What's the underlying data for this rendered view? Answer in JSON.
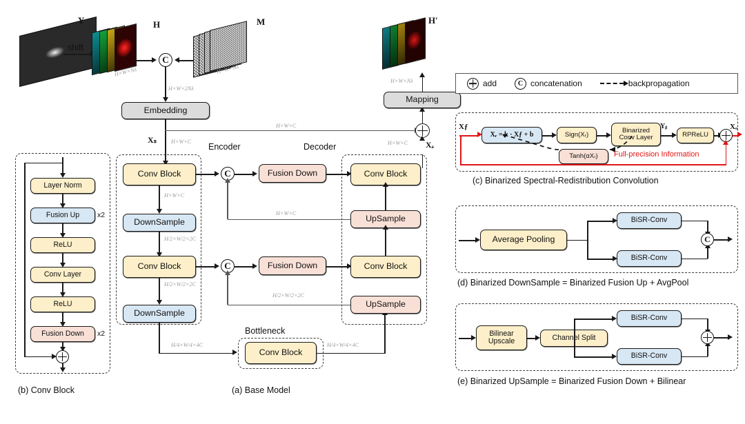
{
  "figure": {
    "panels": {
      "a": {
        "caption": "(a) Base Model",
        "encoder_label": "Encoder",
        "decoder_label": "Decoder",
        "bottleneck_label": "Bottleneck"
      },
      "b": {
        "caption": "(b) Conv Block"
      },
      "c": {
        "caption": "(c) Binarized Spectral-Redistribution Convolution"
      },
      "d": {
        "caption": "(d) Binarized DownSample = Binarized Fusion Up + AvgPool"
      },
      "e": {
        "caption": "(e) Binarized UpSample = Binarized Fusion Down + Bilinear"
      }
    },
    "legend": {
      "add": "add",
      "concatenation": "concatenation",
      "backpropagation": "backpropagation",
      "add_glyph": "plus-circle-icon",
      "concat_glyph": "c-circle-icon",
      "backprop_glyph": "dashed-arrow-icon"
    },
    "input_stage": {
      "measurement_symbol": "Y",
      "shift_label": "shift",
      "cube_symbol": "H",
      "mask_symbol": "M",
      "output_cube_symbol": "H′",
      "dim_cube": "H×W×Nλ",
      "dim_mask": "H×W×Nλ",
      "dim_concat": "H×W×2Nλ",
      "dim_out": "H×W×Nλ"
    },
    "base_model": {
      "embedding": "Embedding",
      "mapping": "Mapping",
      "xs": "Xₛ",
      "xd": "Xₔ",
      "conv_block": "Conv Block",
      "downsample": "DownSample",
      "upsample": "UpSample",
      "fusion_down": "Fusion Down",
      "dims": {
        "skip_top": "H×W×C",
        "xs": "H×W×C",
        "xd": "H×W×C",
        "enc1_out": "H×W×C",
        "skip1": "H×W×C",
        "enc2_in": "H/2×W/2×2C",
        "enc2_out": "H/2×W/2×2C",
        "skip2": "H/2×W/2×2C",
        "bottleneck_in": "H/4×W/4×4C",
        "bottleneck_out": "H/4×W/4×4C"
      }
    },
    "conv_block": {
      "items": [
        {
          "label": "Layer Norm",
          "color": "cream",
          "repeat": ""
        },
        {
          "label": "Fusion Up",
          "color": "blue",
          "repeat": "x2"
        },
        {
          "label": "ReLU",
          "color": "cream",
          "repeat": ""
        },
        {
          "label": "Conv Layer",
          "color": "cream",
          "repeat": ""
        },
        {
          "label": "ReLU",
          "color": "cream",
          "repeat": ""
        },
        {
          "label": "Fusion Down",
          "color": "pink",
          "repeat": "x2"
        }
      ]
    },
    "bisr_conv": {
      "input_symbol": "Xƒ",
      "output_symbol": "Xₒ",
      "yb_symbol": "Yᵦ",
      "affine": "Xᵣ = k · Xƒ + b",
      "sign": "Sign(Xᵣ)",
      "binarized_conv": "Binarized\nConv Layer",
      "binarized_conv_line1": "Binarized",
      "binarized_conv_line2": "Conv Layer",
      "rprelu": "RPReLU",
      "tanh": "Tanh(αXᵣ)",
      "full_precision": "Full-precision Information"
    },
    "downsample_panel": {
      "avgpool": "Average Pooling",
      "branch_top": "BiSR-Conv",
      "branch_bottom": "BiSR-Conv",
      "merge": "concatenation"
    },
    "upsample_panel": {
      "bilinear_line1": "Bilinear",
      "bilinear_line2": "Upscale",
      "channel_split": "Channel Split",
      "branch_top": "BiSR-Conv",
      "branch_bottom": "BiSR-Conv",
      "merge": "add"
    },
    "colors": {
      "cream": "#fcefc9",
      "blue": "#d7e7f4",
      "pink": "#f9e0d7",
      "grey": "#dcdcdc",
      "red_accent": "#e11414",
      "dim_text": "#9a9a9a",
      "outline": "#1a1a1a"
    }
  }
}
